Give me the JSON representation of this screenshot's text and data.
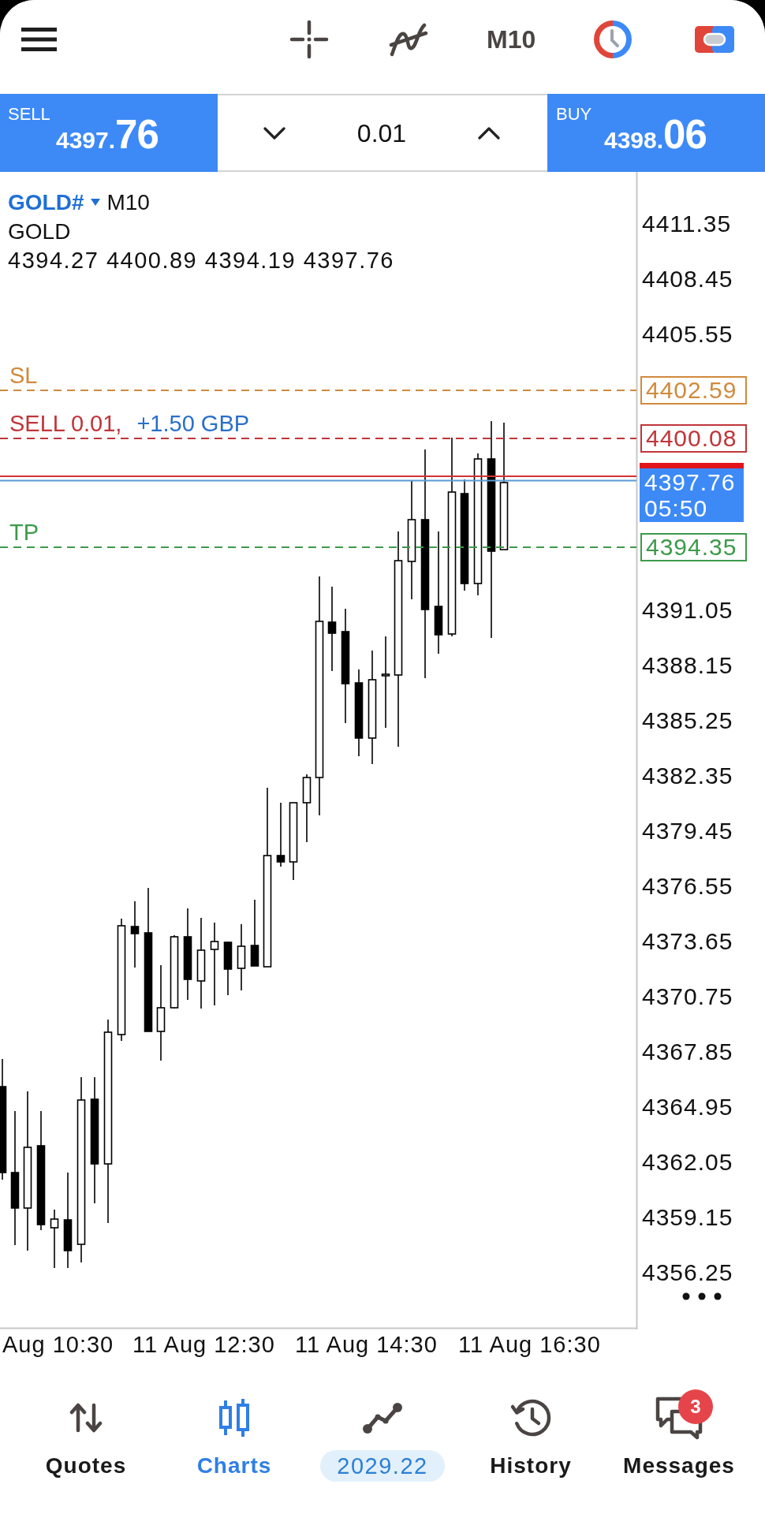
{
  "toolbar": {
    "timeframe": "M10"
  },
  "trade_panel": {
    "sell": {
      "label": "SELL",
      "price": "4397.",
      "price_large": "76"
    },
    "volume": "0.01",
    "buy": {
      "label": "BUY",
      "price": "4398.",
      "price_large": "06"
    }
  },
  "chart": {
    "symbol": "GOLD#",
    "timeframe": "M10",
    "description": "GOLD",
    "ohlc": "4394.27 4400.89 4394.19 4397.76",
    "price_lines": [
      {
        "kind": "sl",
        "label": "SL",
        "price": "4402.59",
        "color": "#d08a3c"
      },
      {
        "kind": "order",
        "label": "SELL 0.01,",
        "profit": "+1.50 GBP",
        "price": "4400.08",
        "color": "#c0353a"
      },
      {
        "kind": "tp",
        "label": "TP",
        "price": "4394.35",
        "color": "#3c9a4a"
      }
    ],
    "bid": {
      "price": "4397.76",
      "countdown": "05:50"
    },
    "y_axis_labels": [
      "4411.35",
      "4408.45",
      "4405.55",
      "4391.05",
      "4388.15",
      "4385.25",
      "4382.35",
      "4379.45",
      "4376.55",
      "4373.65",
      "4370.75",
      "4367.85",
      "4364.95",
      "4362.05",
      "4359.15",
      "4356.25"
    ],
    "x_axis_labels": [
      "Aug 10:30",
      "11 Aug 12:30",
      "11 Aug 14:30",
      "11 Aug 16:30"
    ]
  },
  "tabs": [
    {
      "kind": "quotes",
      "label": "Quotes",
      "selected": false
    },
    {
      "kind": "charts",
      "label": "Charts",
      "selected": true
    },
    {
      "kind": "trade",
      "label": "2029.22",
      "selected": false
    },
    {
      "kind": "history",
      "label": "History",
      "selected": false
    },
    {
      "kind": "messages",
      "label": "Messages",
      "badge": "3",
      "selected": false
    }
  ]
}
